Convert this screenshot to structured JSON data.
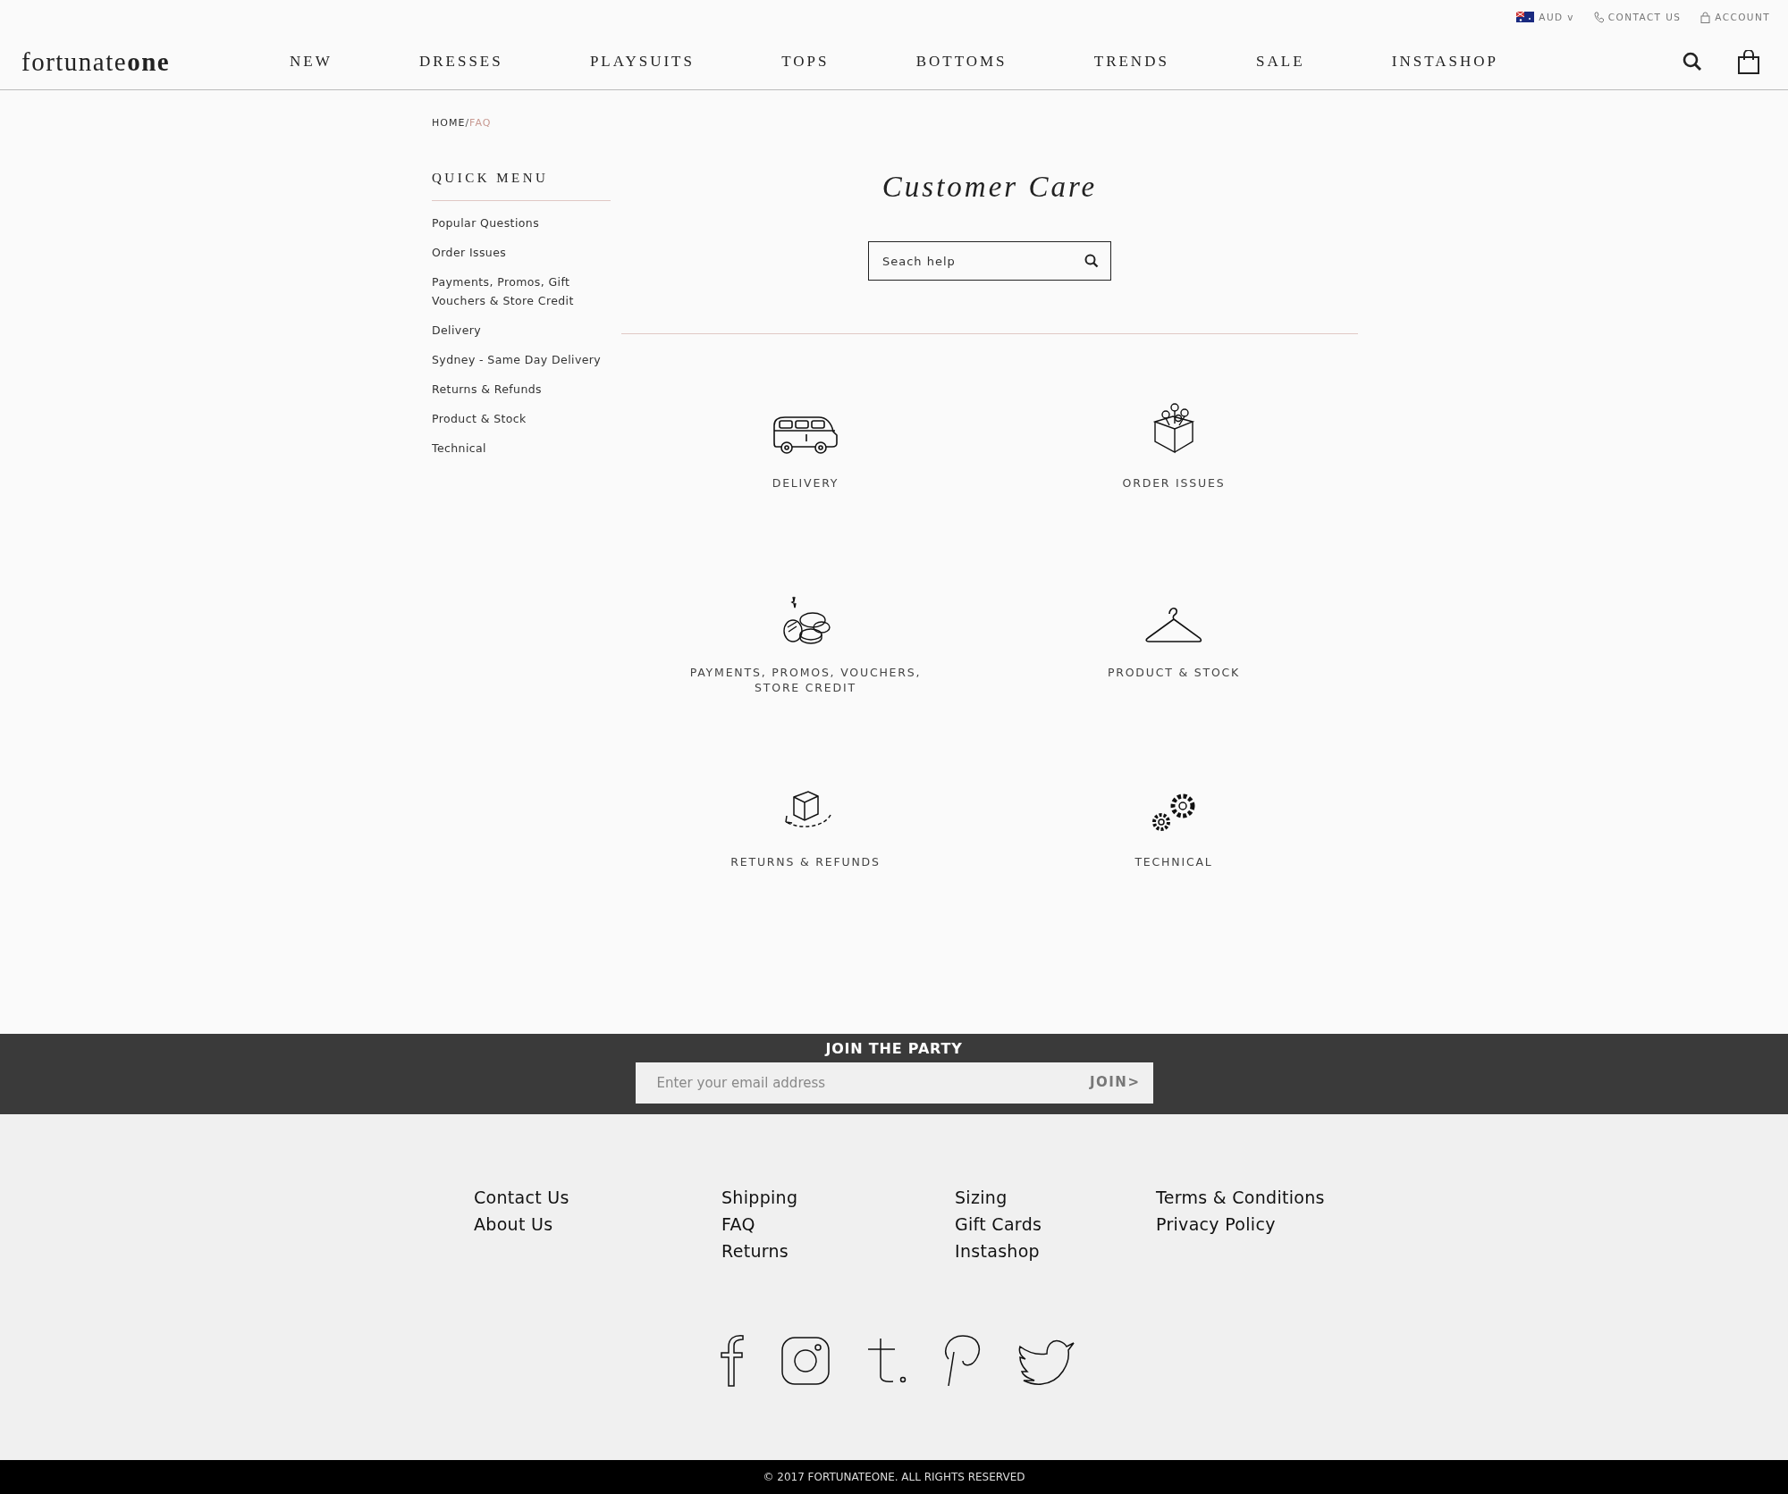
{
  "top_bar": {
    "currency": "AUD",
    "currency_caret": "v",
    "contact": "CONTACT US",
    "account": "ACCOUNT"
  },
  "header": {
    "logo": "fortunate**one**",
    "nav": [
      "NEW",
      "DRESSES",
      "PLAYSUITS",
      "TOPS",
      "BOTTOMS",
      "TRENDS",
      "SALE",
      "INSTASHOP"
    ]
  },
  "breadcrumb": {
    "separator": "/",
    "items": [
      {
        "label": "HOME",
        "selected": false
      },
      {
        "label": "FAQ",
        "selected": true
      }
    ]
  },
  "quick_menu": {
    "title": "QUICK MENU",
    "items": [
      "Popular Questions",
      "Order Issues",
      "Payments, Promos, Gift Vouchers & Store Credit",
      "Delivery",
      "Sydney - Same Day Delivery",
      "Returns & Refunds",
      "Product & Stock",
      "Technical"
    ]
  },
  "title": "Customer Care",
  "search": {
    "placeholder": "Seach help"
  },
  "categories": [
    {
      "label": "DELIVERY",
      "kind": "van"
    },
    {
      "label": "ORDER ISSUES",
      "kind": "plant"
    },
    {
      "label": "PAYMENTS, PROMOS, VOUCHERS, STORE CREDIT",
      "kind": "coins"
    },
    {
      "label": "PRODUCT & STOCK",
      "kind": "hanger"
    },
    {
      "label": "RETURNS & REFUNDS",
      "kind": "box"
    },
    {
      "label": "TECHNICAL",
      "kind": "gears"
    }
  ],
  "newsletter": {
    "title": "JOIN THE PARTY",
    "placeholder": "Enter your email address",
    "button": "JOIN>"
  },
  "footer": {
    "columns": [
      [
        "Contact Us",
        "About Us"
      ],
      [
        "Shipping",
        "FAQ",
        "Returns"
      ],
      [
        "Sizing",
        "Gift Cards",
        "Instashop"
      ],
      [
        "Terms & Conditions",
        "Privacy Policy"
      ]
    ],
    "social": [
      {
        "kind": "facebook"
      },
      {
        "kind": "instagram"
      },
      {
        "kind": "tumblr"
      },
      {
        "kind": "pinterest"
      },
      {
        "kind": "twitter"
      }
    ],
    "copyright": "© 2017 FORTUNATEONE. ALL RIGHTS RESERVED"
  }
}
